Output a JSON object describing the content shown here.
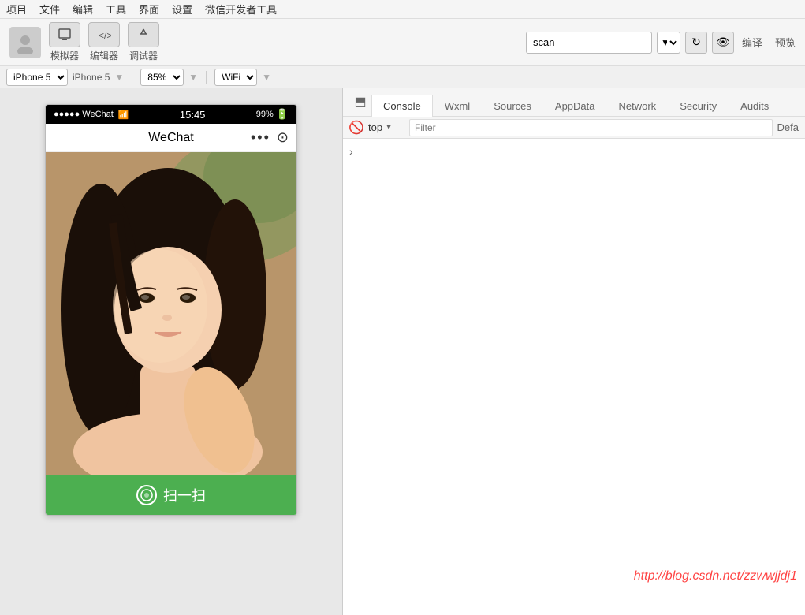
{
  "menubar": {
    "items": [
      "项目",
      "文件",
      "编辑",
      "工具",
      "界面",
      "设置",
      "微信开发者工具"
    ]
  },
  "toolbar": {
    "simulator_label": "模拟器",
    "editor_label": "编辑器",
    "debugger_label": "调试器",
    "search_value": "scan",
    "translate_label": "编译",
    "preview_label": "预览"
  },
  "device_bar": {
    "device": "iPhone 5",
    "zoom": "85%",
    "network": "WiFi"
  },
  "phone": {
    "carrier": "●●●●● WeChat",
    "wifi_icon": "📶",
    "time": "15:45",
    "battery": "99%",
    "title": "WeChat",
    "scan_label": "扫一扫"
  },
  "devtools": {
    "tabs": [
      "Console",
      "Wxml",
      "Sources",
      "AppData",
      "Network",
      "Security",
      "Audits"
    ],
    "active_tab": "Console",
    "context": "top",
    "filter_placeholder": "Filter",
    "default_label": "Defa",
    "watermark": "http://blog.csdn.net/zzwwjjdj1"
  }
}
